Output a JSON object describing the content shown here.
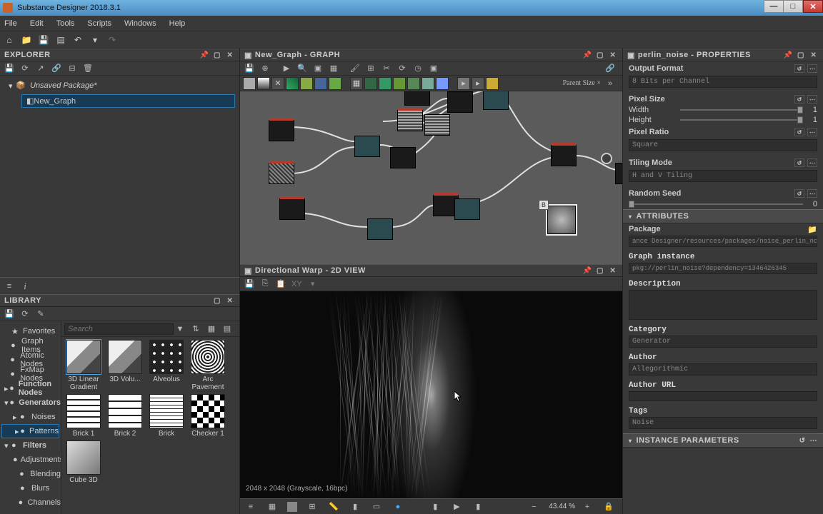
{
  "app": {
    "title": "Substance Designer 2018.3.1"
  },
  "menu": [
    "File",
    "Edit",
    "Tools",
    "Scripts",
    "Windows",
    "Help"
  ],
  "explorer": {
    "title": "EXPLORER",
    "package": "Unsaved Package*",
    "graph": "New_Graph"
  },
  "library": {
    "title": "LIBRARY",
    "search_placeholder": "Search",
    "tree": [
      {
        "label": "Favorites",
        "icon": "star",
        "expand": ""
      },
      {
        "label": "Graph Items",
        "icon": "dot",
        "expand": ""
      },
      {
        "label": "Atomic Nodes",
        "icon": "dot",
        "expand": ""
      },
      {
        "label": "FxMap Nodes",
        "icon": "dot",
        "expand": ""
      },
      {
        "label": "Function Nodes",
        "icon": "dot",
        "expand": "▸",
        "bold": true
      },
      {
        "label": "Generators",
        "icon": "dot",
        "expand": "▾",
        "bold": true
      },
      {
        "label": "Noises",
        "icon": "dot",
        "expand": "▸",
        "indent": true
      },
      {
        "label": "Patterns",
        "icon": "dot",
        "expand": "▸",
        "indent": true,
        "sel": true
      },
      {
        "label": "Filters",
        "icon": "dot",
        "expand": "▾",
        "bold": true
      },
      {
        "label": "Adjustments",
        "icon": "dot",
        "expand": "",
        "indent": true
      },
      {
        "label": "Blending",
        "icon": "dot",
        "expand": "",
        "indent": true
      },
      {
        "label": "Blurs",
        "icon": "dot",
        "expand": "",
        "indent": true
      },
      {
        "label": "Channels",
        "icon": "dot",
        "expand": "",
        "indent": true
      }
    ],
    "items": [
      {
        "label": "3D Linear Gradient",
        "thumb": "cube",
        "sel": true
      },
      {
        "label": "3D Volu...",
        "thumb": "cube"
      },
      {
        "label": "Alveolus",
        "thumb": "dots"
      },
      {
        "label": "Arc Pavement",
        "thumb": "arcs"
      },
      {
        "label": "Brick 1",
        "thumb": "brick1"
      },
      {
        "label": "Brick 2",
        "thumb": "brick2"
      },
      {
        "label": "Brick",
        "thumb": "brick3"
      },
      {
        "label": "Checker 1",
        "thumb": "checker"
      },
      {
        "label": "Cube 3D",
        "thumb": "cube3d"
      }
    ]
  },
  "graph": {
    "title": "New_Graph - GRAPH",
    "parent_size": "Parent Size ×"
  },
  "view2d": {
    "title": "Directional Warp - 2D VIEW",
    "info": "2048 x 2048 (Grayscale, 16bpc)",
    "status_zoom": "43.44 %",
    "xy": "XY"
  },
  "props": {
    "title": "perlin_noise - PROPERTIES",
    "output_format": {
      "label": "Output Format",
      "value": "8 Bits per Channel"
    },
    "pixel_size": {
      "label": "Pixel Size",
      "width_lbl": "Width",
      "width_val": "1",
      "height_lbl": "Height",
      "height_val": "1"
    },
    "pixel_ratio": {
      "label": "Pixel Ratio",
      "value": "Square"
    },
    "tiling_mode": {
      "label": "Tiling Mode",
      "value": "H and V Tiling"
    },
    "random_seed": {
      "label": "Random Seed",
      "value": "0"
    },
    "attributes": {
      "title": "ATTRIBUTES",
      "package_lbl": "Package",
      "package_val": "ance Designer/resources/packages/noise_perlin_noise.sbs",
      "graph_inst_lbl": "Graph instance",
      "graph_inst_val": "pkg://perlin_noise?dependency=1346426345",
      "description_lbl": "Description",
      "category_lbl": "Category",
      "category_val": "Generator",
      "author_lbl": "Author",
      "author_val": "Allegorithmic",
      "url_lbl": "Author URL",
      "tags_lbl": "Tags",
      "tags_val": "Noise"
    },
    "instance_params": "INSTANCE PARAMETERS"
  }
}
